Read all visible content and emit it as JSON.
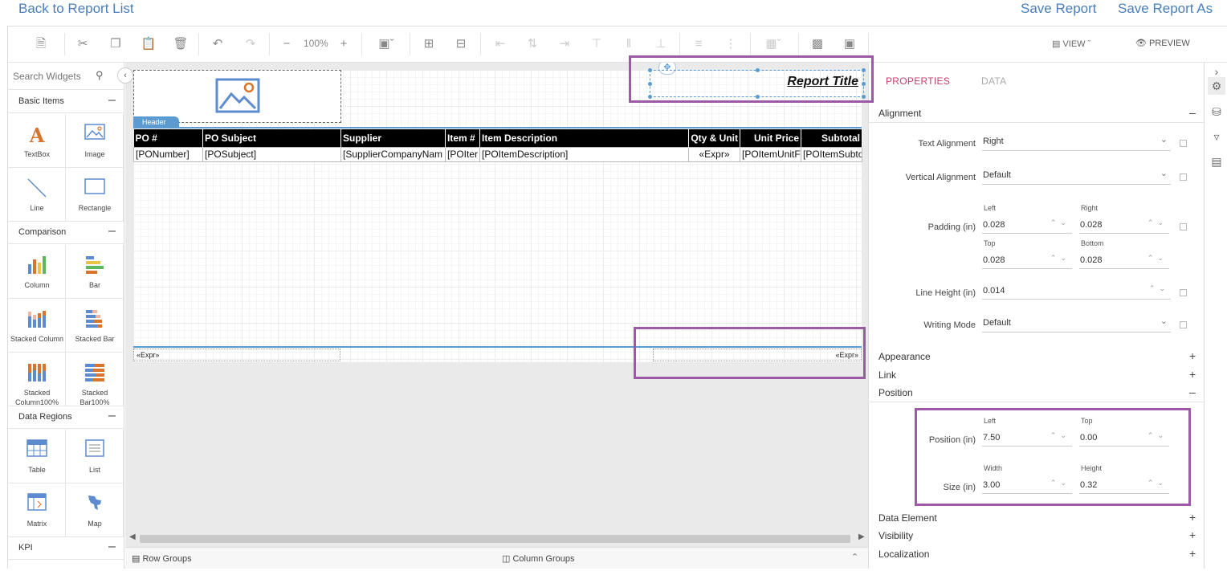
{
  "top": {
    "back": "Back to Report List",
    "save": "Save Report",
    "save_as": "Save Report As"
  },
  "toolbar": {
    "zoom": "100%",
    "view": "VIEW",
    "preview": "PREVIEW"
  },
  "widgets": {
    "search_placeholder": "Search Widgets",
    "categories": [
      "Basic Items",
      "Comparison",
      "Data Regions",
      "KPI"
    ],
    "items": {
      "textbox": "TextBox",
      "image": "Image",
      "line": "Line",
      "rectangle": "Rectangle",
      "column": "Column",
      "bar": "Bar",
      "stacked_column": "Stacked Column",
      "stacked_bar": "Stacked Bar",
      "stacked_column100": "Stacked Column100%",
      "stacked_bar100": "Stacked Bar100%",
      "table": "Table",
      "list": "List",
      "matrix": "Matrix",
      "map": "Map"
    }
  },
  "report": {
    "header_tab": "Header",
    "title": "Report Title",
    "columns": [
      "PO #",
      "PO Subject",
      "Supplier",
      "Item #",
      "Item Description",
      "Qty & Unit",
      "Unit Price",
      "Subtotal"
    ],
    "row": [
      "[PONumber]",
      "[POSubject]",
      "[SupplierCompanyNam",
      "[POIter",
      "[POItemDescription]",
      "«Expr»",
      "[POItemUnitF",
      "[POItemSubto"
    ],
    "footer_left": "«Expr»",
    "footer_right": "«Expr»"
  },
  "groups": {
    "row": "Row Groups",
    "column": "Column Groups"
  },
  "properties": {
    "tabs": {
      "properties": "PROPERTIES",
      "data": "DATA"
    },
    "sections": {
      "alignment": "Alignment",
      "appearance": "Appearance",
      "link": "Link",
      "position": "Position",
      "data_element": "Data Element",
      "visibility": "Visibility",
      "localization": "Localization"
    },
    "text_alignment": {
      "label": "Text Alignment",
      "value": "Right"
    },
    "vertical_alignment": {
      "label": "Vertical Alignment",
      "value": "Default"
    },
    "padding": {
      "label": "Padding (in)",
      "left_label": "Left",
      "right_label": "Right",
      "top_label": "Top",
      "bottom_label": "Bottom",
      "left": "0.028",
      "right": "0.028",
      "top": "0.028",
      "bottom": "0.028"
    },
    "line_height": {
      "label": "Line Height (in)",
      "value": "0.014"
    },
    "writing_mode": {
      "label": "Writing Mode",
      "value": "Default"
    },
    "position": {
      "label": "Position (in)",
      "left_label": "Left",
      "top_label": "Top",
      "left": "7.50",
      "top": "0.00"
    },
    "size": {
      "label": "Size (in)",
      "width_label": "Width",
      "height_label": "Height",
      "width": "3.00",
      "height": "0.32"
    }
  },
  "colors": {
    "accent_tab": "#c2416c",
    "link": "#4a7eb8",
    "highlight": "#9b59a6",
    "band": "#5c9bd1"
  }
}
